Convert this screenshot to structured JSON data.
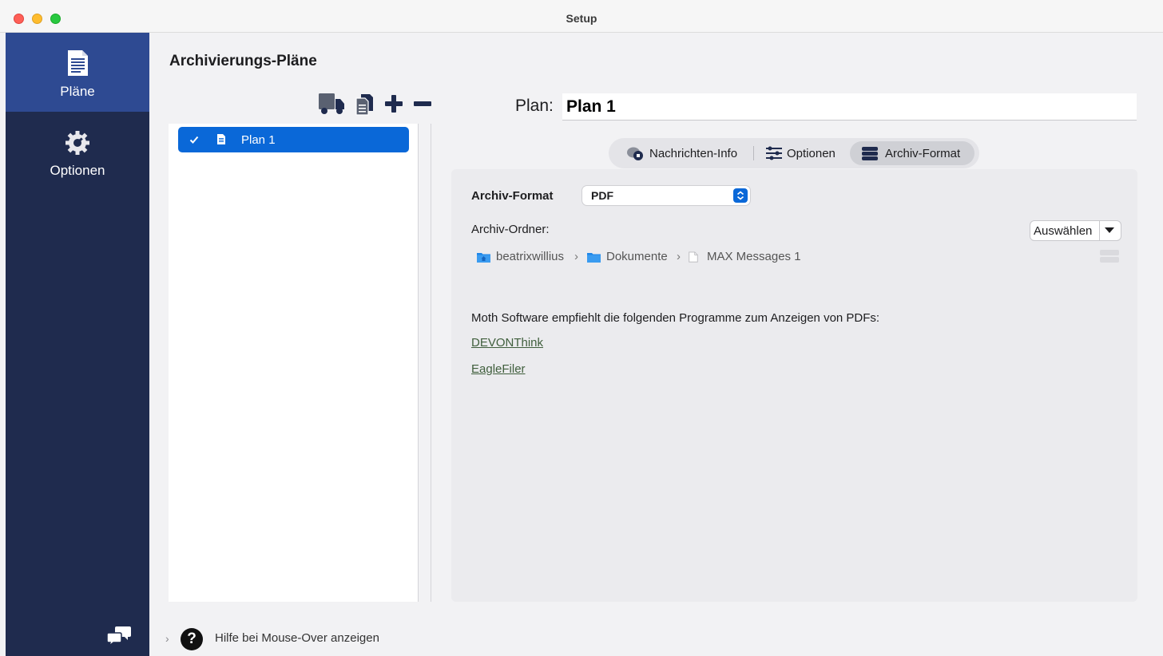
{
  "window": {
    "title": "Setup"
  },
  "sidebar": {
    "items": [
      {
        "label": "Pläne",
        "icon": "document-icon",
        "active": true
      },
      {
        "label": "Optionen",
        "icon": "gear-icon",
        "active": false
      }
    ],
    "footer_icon": "chat-bubbles-icon"
  },
  "plans": {
    "title": "Archivierungs-Pläne",
    "toolbar": [
      "truck-icon",
      "duplicate-icon",
      "plus-icon",
      "minus-icon"
    ],
    "items": [
      {
        "name": "Plan 1",
        "checked": true,
        "selected": true
      }
    ]
  },
  "plan_editor": {
    "name_label": "Plan:",
    "name_value": "Plan 1",
    "tabs": [
      {
        "label": "Nachrichten-Info",
        "icon": "message-info-icon",
        "active": false
      },
      {
        "label": "Optionen",
        "icon": "sliders-icon",
        "active": false
      },
      {
        "label": "Archiv-Format",
        "icon": "database-icon",
        "active": true
      }
    ],
    "format": {
      "label": "Archiv-Format",
      "value": "PDF",
      "folder_label": "Archiv-Ordner:",
      "choose_label": "Auswählen",
      "path": [
        {
          "name": "beatrixwillius",
          "icon": "home-folder-icon"
        },
        {
          "name": "Dokumente",
          "icon": "folder-icon"
        },
        {
          "name": "MAX Messages 1",
          "icon": "file-icon"
        }
      ],
      "path_separator": "›",
      "recommendation": "Moth Software empfiehlt die folgenden Programme zum Anzeigen von PDFs:",
      "links": [
        "DEVONThink",
        "EagleFiler"
      ]
    }
  },
  "footer": {
    "help_symbol": "?",
    "help_text": "Hilfe bei Mouse-Over anzeigen",
    "disclosure": "›"
  },
  "colors": {
    "sidebar_bg": "#1f2b4e",
    "sidebar_active": "#2e4a92",
    "selection_blue": "#0a68d8",
    "link_green": "#3f5e3c"
  }
}
